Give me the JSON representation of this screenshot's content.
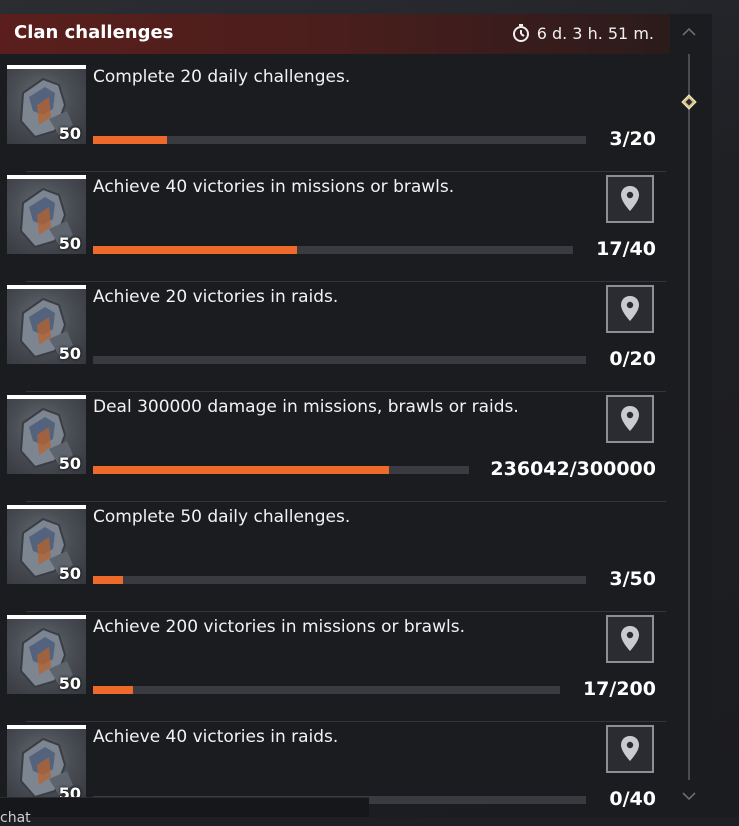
{
  "header": {
    "title": "Clan challenges",
    "timer": "6 d. 3 h. 51 m."
  },
  "challenges": [
    {
      "text": "Complete 20 daily challenges.",
      "reward": "50",
      "progress": "3/20",
      "fraction": 0.15,
      "has_locate": false
    },
    {
      "text": "Achieve 40 victories in missions or brawls.",
      "reward": "50",
      "progress": "17/40",
      "fraction": 0.425,
      "has_locate": true
    },
    {
      "text": "Achieve 20 victories in raids.",
      "reward": "50",
      "progress": "0/20",
      "fraction": 0.0,
      "has_locate": true
    },
    {
      "text": "Deal 300000 damage in missions, brawls or raids.",
      "reward": "50",
      "progress": "236042/300000",
      "fraction": 0.7868,
      "has_locate": true
    },
    {
      "text": "Complete 50 daily challenges.",
      "reward": "50",
      "progress": "3/50",
      "fraction": 0.06,
      "has_locate": false
    },
    {
      "text": "Achieve 200 victories in missions or brawls.",
      "reward": "50",
      "progress": "17/200",
      "fraction": 0.085,
      "has_locate": true
    },
    {
      "text": "Achieve 40 victories in raids.",
      "reward": "50",
      "progress": "0/40",
      "fraction": 0.0,
      "has_locate": true
    }
  ],
  "chat": {
    "label": "chat"
  },
  "colors": {
    "accent": "#ee6a2a",
    "header_red": "#5a1f1c",
    "panel_bg": "#1b1c20"
  },
  "icons": {
    "timer": "stopwatch-icon",
    "locate": "map-pin-icon",
    "reward": "wrench-token-icon",
    "scroll_thumb": "diamond-icon"
  }
}
